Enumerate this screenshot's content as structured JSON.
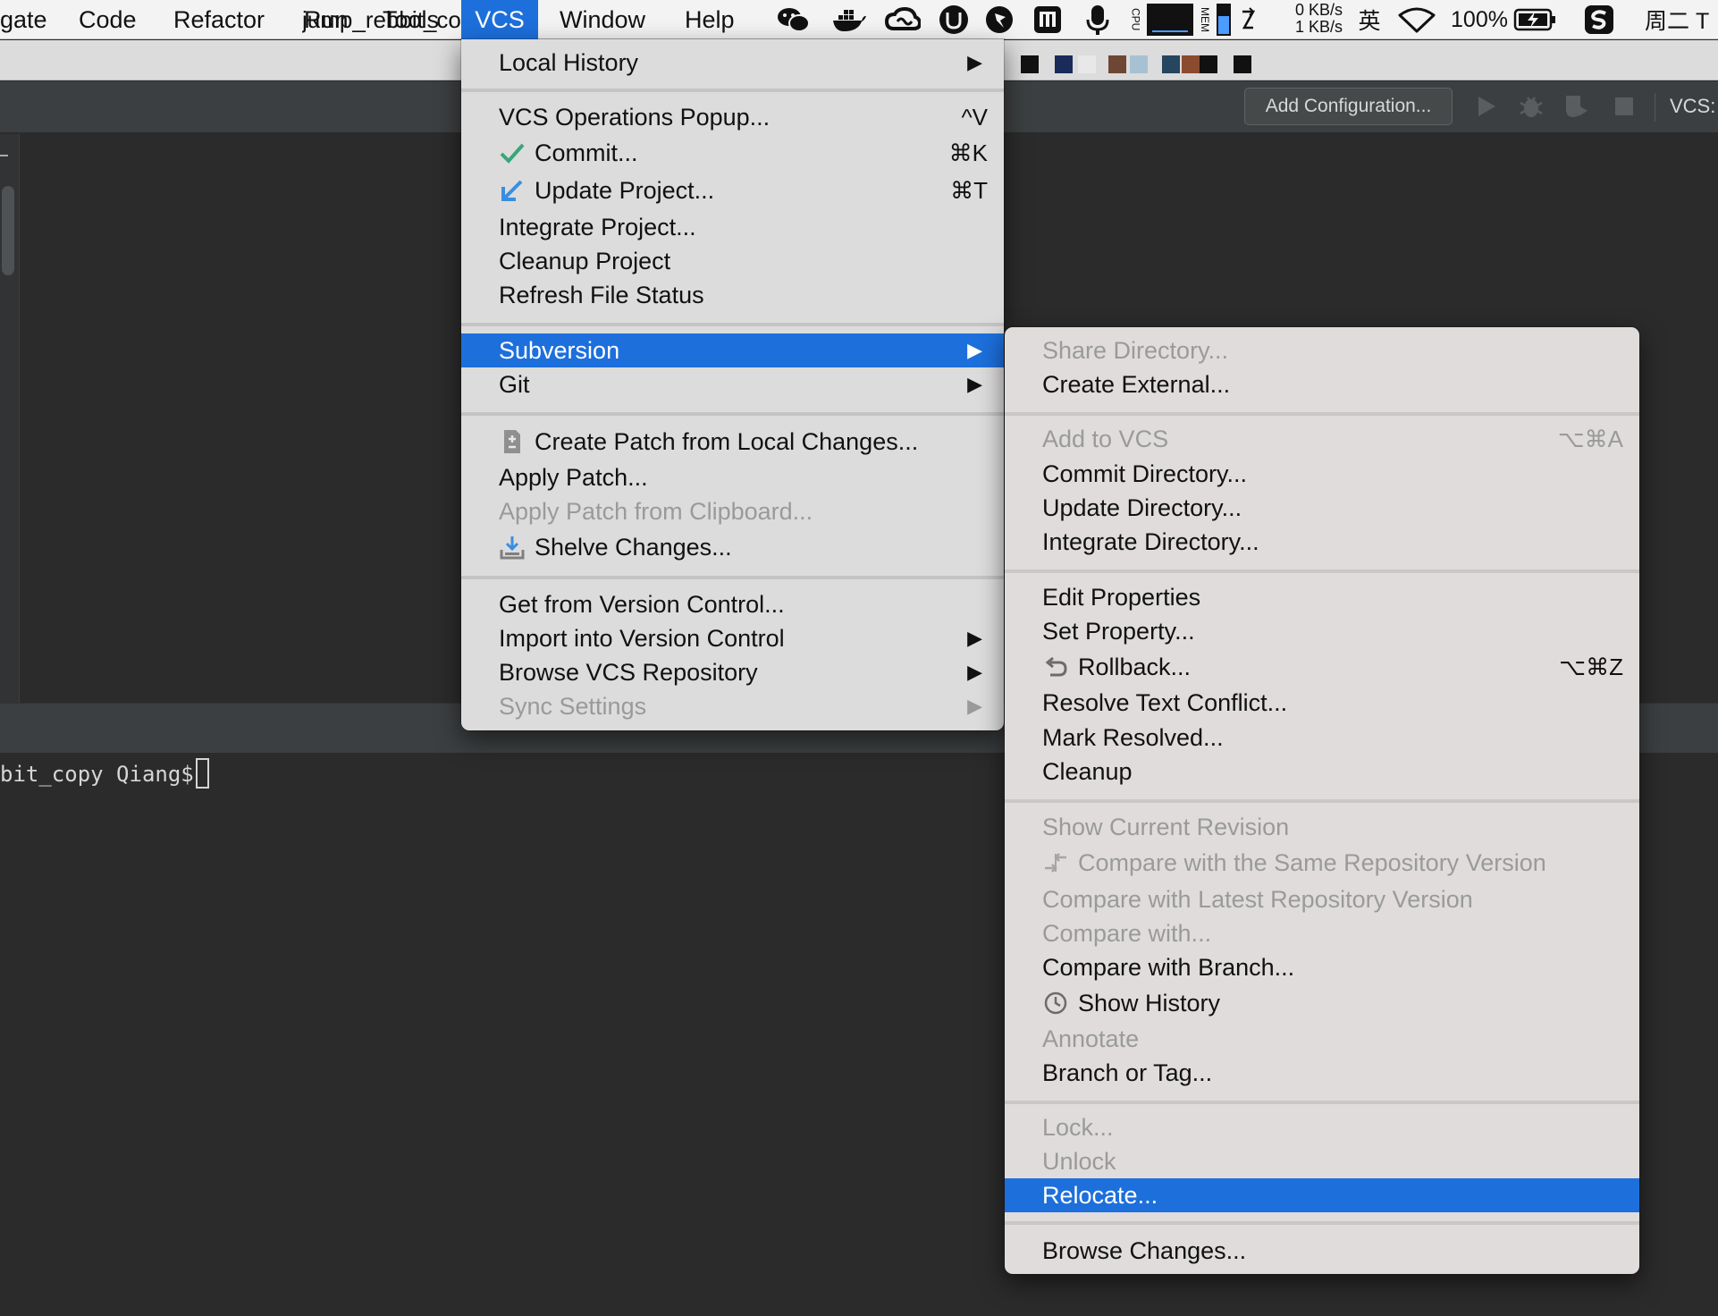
{
  "menubar": {
    "items": [
      "gate",
      "Code",
      "Refactor",
      "Run",
      "Tools",
      "VCS",
      "Window",
      "Help"
    ],
    "active": "VCS",
    "net_up": "0 KB/s",
    "net_down": "1 KB/s",
    "input_method": "英",
    "battery": "100%",
    "clock": "周二 T",
    "cpu_label": "CPU",
    "mem_label": "MEM",
    "tray_icons": [
      "wechat-icon",
      "docker-icon",
      "creative-cloud-icon",
      "shield-icon",
      "pin-icon",
      "istat-icon",
      "microphone-icon",
      "cpu-meter-icon",
      "mem-meter-icon",
      "sync-icon",
      "wifi-icon",
      "battery-icon",
      "sogou-icon"
    ],
    "accent": "#1d6fdc"
  },
  "tab": {
    "title": "jump_rebbit_co"
  },
  "toolbar": {
    "add_configuration": "Add Configuration...",
    "vcs_label": "VCS:"
  },
  "terminal": {
    "prompt": "bit_copy Qiang$"
  },
  "vcs_menu": {
    "local_history": "Local History",
    "vcs_operations_popup": "VCS Operations Popup...",
    "vcs_operations_popup_shortcut": "^V",
    "commit": "Commit...",
    "commit_shortcut": "⌘K",
    "update_project": "Update Project...",
    "update_project_shortcut": "⌘T",
    "integrate_project": "Integrate Project...",
    "cleanup_project": "Cleanup Project",
    "refresh_file_status": "Refresh File Status",
    "subversion": "Subversion",
    "git": "Git",
    "create_patch": "Create Patch from Local Changes...",
    "apply_patch": "Apply Patch...",
    "apply_patch_clipboard": "Apply Patch from Clipboard...",
    "shelve_changes": "Shelve Changes...",
    "get_from_vcs": "Get from Version Control...",
    "import_into_vcs": "Import into Version Control",
    "browse_vcs_repository": "Browse VCS Repository",
    "sync_settings": "Sync Settings"
  },
  "svn_menu": {
    "share_directory": "Share Directory...",
    "create_external": "Create External...",
    "add_to_vcs": "Add to VCS",
    "add_to_vcs_shortcut": "⌥⌘A",
    "commit_directory": "Commit Directory...",
    "update_directory": "Update Directory...",
    "integrate_directory": "Integrate Directory...",
    "edit_properties": "Edit Properties",
    "set_property": "Set Property...",
    "rollback": "Rollback...",
    "rollback_shortcut": "⌥⌘Z",
    "resolve_text_conflict": "Resolve Text Conflict...",
    "mark_resolved": "Mark Resolved...",
    "cleanup": "Cleanup",
    "show_current_revision": "Show Current Revision",
    "compare_same_repo": "Compare with the Same Repository Version",
    "compare_latest_repo": "Compare with Latest Repository Version",
    "compare_with": "Compare with...",
    "compare_with_branch": "Compare with Branch...",
    "show_history": "Show History",
    "annotate": "Annotate",
    "branch_or_tag": "Branch or Tag...",
    "lock": "Lock...",
    "unlock": "Unlock",
    "relocate": "Relocate...",
    "browse_changes": "Browse Changes..."
  }
}
